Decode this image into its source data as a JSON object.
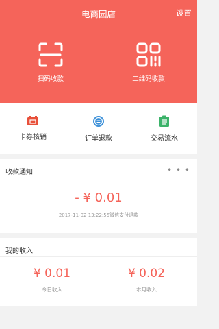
{
  "header": {
    "title": "电商园店",
    "settings_label": "设置",
    "scan_label": "扫码收款",
    "qr_label": "二维码收款",
    "background": "#f5645a"
  },
  "quick_actions": [
    {
      "label": "卡券核销",
      "icon": "ticket-icon",
      "color": "#e8503a"
    },
    {
      "label": "订单退款",
      "icon": "refund-icon",
      "color": "#3a8fd8"
    },
    {
      "label": "交易流水",
      "icon": "clipboard-icon",
      "color": "#3cb36a"
    }
  ],
  "notice": {
    "title": "收款通知",
    "more": "• • •",
    "amount": "- ¥ 0.01",
    "meta": "2017-11-02 13:22:55微信支付退款"
  },
  "income": {
    "title": "我的收入",
    "today_value": "¥ 0.01",
    "today_label": "今日收入",
    "month_value": "¥ 0.02",
    "month_label": "本月收入"
  }
}
